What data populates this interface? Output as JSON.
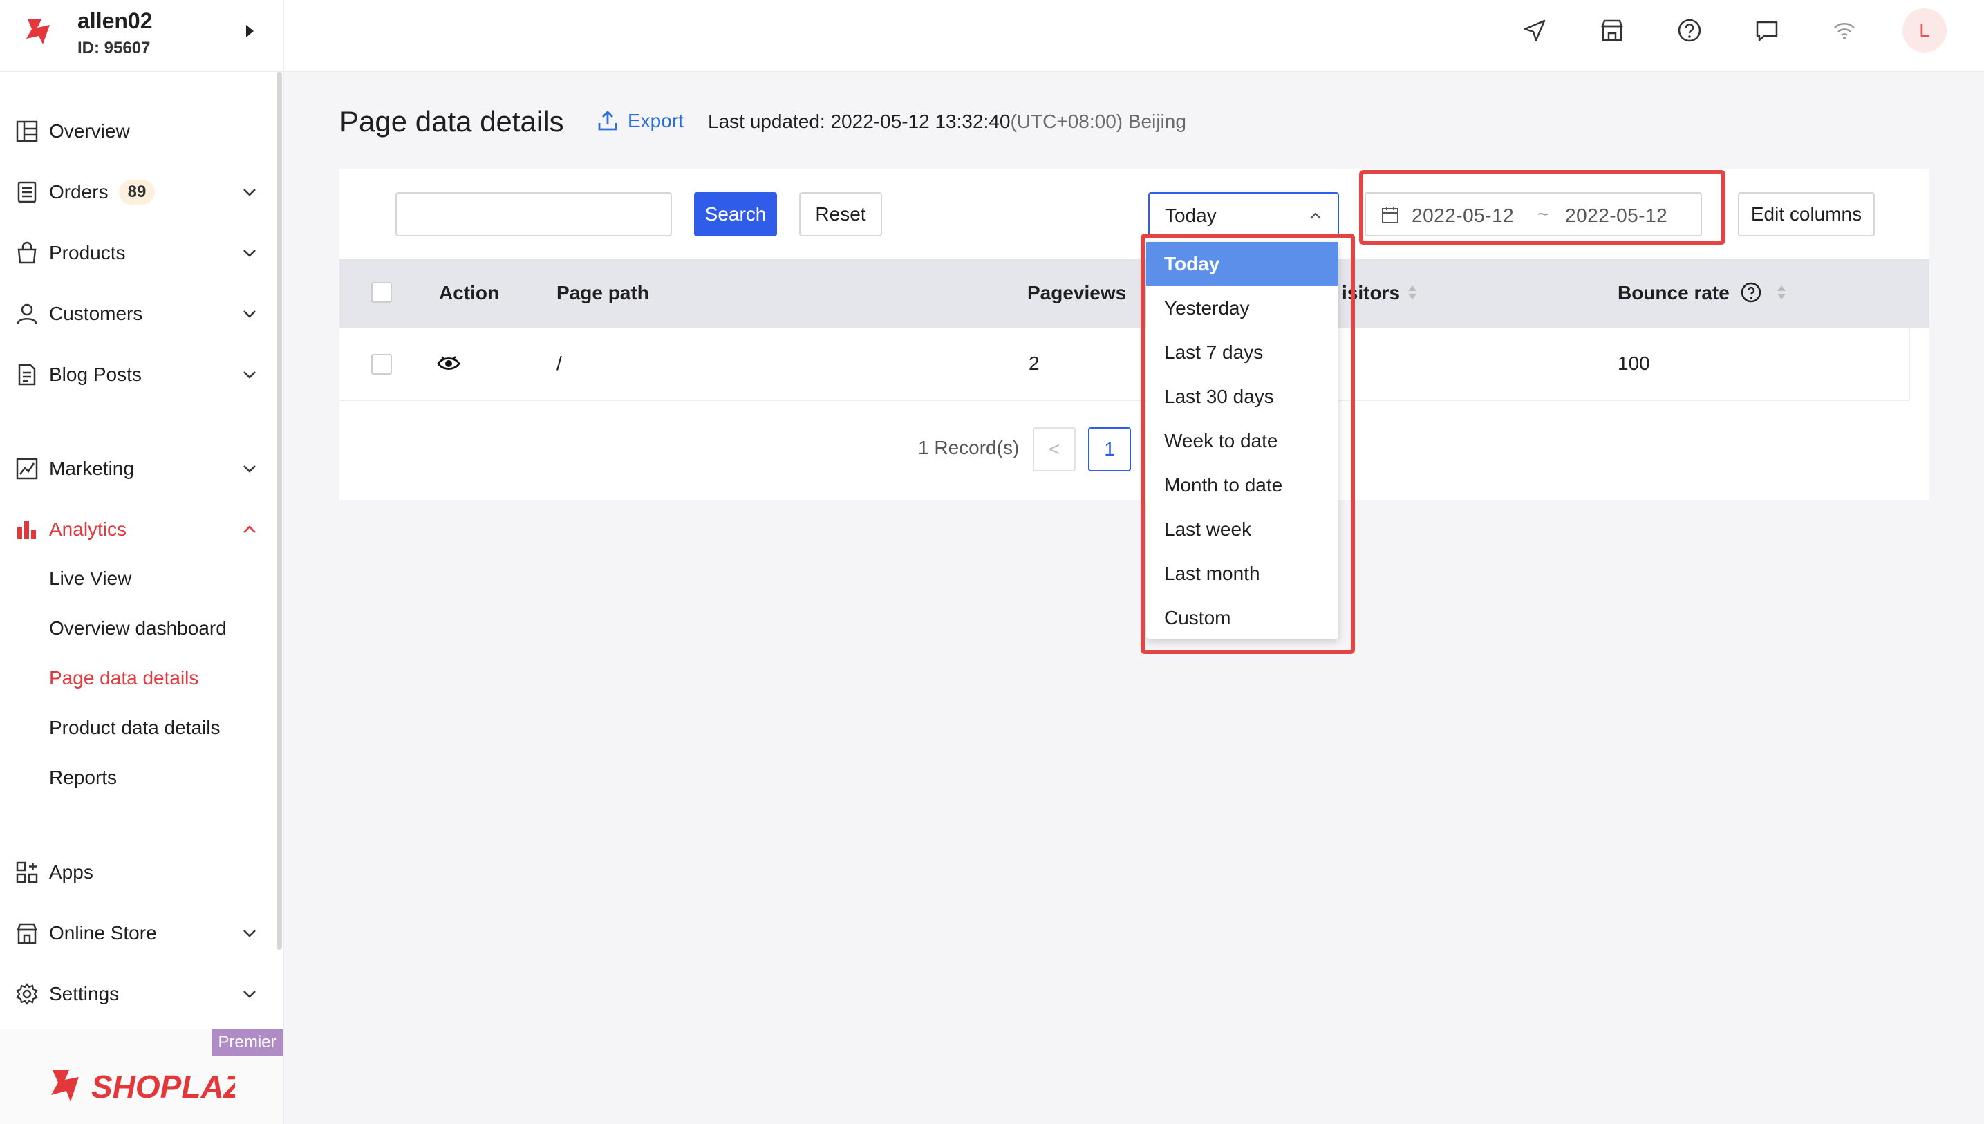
{
  "account": {
    "name": "allen02",
    "id": "ID: 95607"
  },
  "sidebar": {
    "items": [
      {
        "key": "overview",
        "label": "Overview",
        "icon": "overview-icon"
      },
      {
        "key": "orders",
        "label": "Orders",
        "badge": "89",
        "icon": "orders-icon"
      },
      {
        "key": "products",
        "label": "Products",
        "icon": "bag-icon"
      },
      {
        "key": "customers",
        "label": "Customers",
        "icon": "person-icon"
      },
      {
        "key": "blog",
        "label": "Blog Posts",
        "icon": "document-icon"
      },
      {
        "key": "marketing",
        "label": "Marketing",
        "icon": "marketing-icon"
      },
      {
        "key": "analytics",
        "label": "Analytics",
        "icon": "bar-chart-icon",
        "active": true
      },
      {
        "key": "apps",
        "label": "Apps",
        "icon": "apps-icon"
      },
      {
        "key": "online_store",
        "label": "Online Store",
        "icon": "store-icon"
      },
      {
        "key": "settings",
        "label": "Settings",
        "icon": "gear-icon"
      }
    ],
    "analytics_sub": [
      {
        "label": "Live View"
      },
      {
        "label": "Overview dashboard"
      },
      {
        "label": "Page data details",
        "active": true
      },
      {
        "label": "Product data details"
      },
      {
        "label": "Reports"
      }
    ],
    "premier_label": "Premier",
    "brand": "SHOPLAZZA"
  },
  "topbar": {
    "icons": [
      "send-icon",
      "store-icon",
      "help-icon",
      "chat-icon",
      "wifi-icon"
    ],
    "avatar_letter": "L"
  },
  "header": {
    "title": "Page data details",
    "export_label": "Export",
    "updated_prefix": "Last updated: 2022-05-12 13:32:40",
    "updated_tz": "(UTC+08:00) Beijing"
  },
  "filters": {
    "search_value": "",
    "search_button": "Search",
    "reset_button": "Reset",
    "period_selected": "Today",
    "date_start": "2022-05-12",
    "date_sep": "~",
    "date_end": "2022-05-12",
    "edit_columns": "Edit columns"
  },
  "table": {
    "columns": [
      "Action",
      "Page path",
      "Pageviews",
      "Visitors",
      "Bounce rate"
    ],
    "visitors_visible": "isitors",
    "rows": [
      {
        "page_path": "/",
        "pageviews": "2",
        "bounce_rate": "100"
      }
    ]
  },
  "pagination": {
    "records": "1 Record(s)",
    "prev": "<",
    "current": "1",
    "more": "."
  },
  "dropdown": {
    "options": [
      "Today",
      "Yesterday",
      "Last 7 days",
      "Last 30 days",
      "Week to date",
      "Month to date",
      "Last week",
      "Last month",
      "Custom"
    ],
    "selected": "Today"
  },
  "colors": {
    "accent": "#2f5ce8",
    "brand_red": "#e3383b",
    "highlight_box": "#e44444"
  }
}
